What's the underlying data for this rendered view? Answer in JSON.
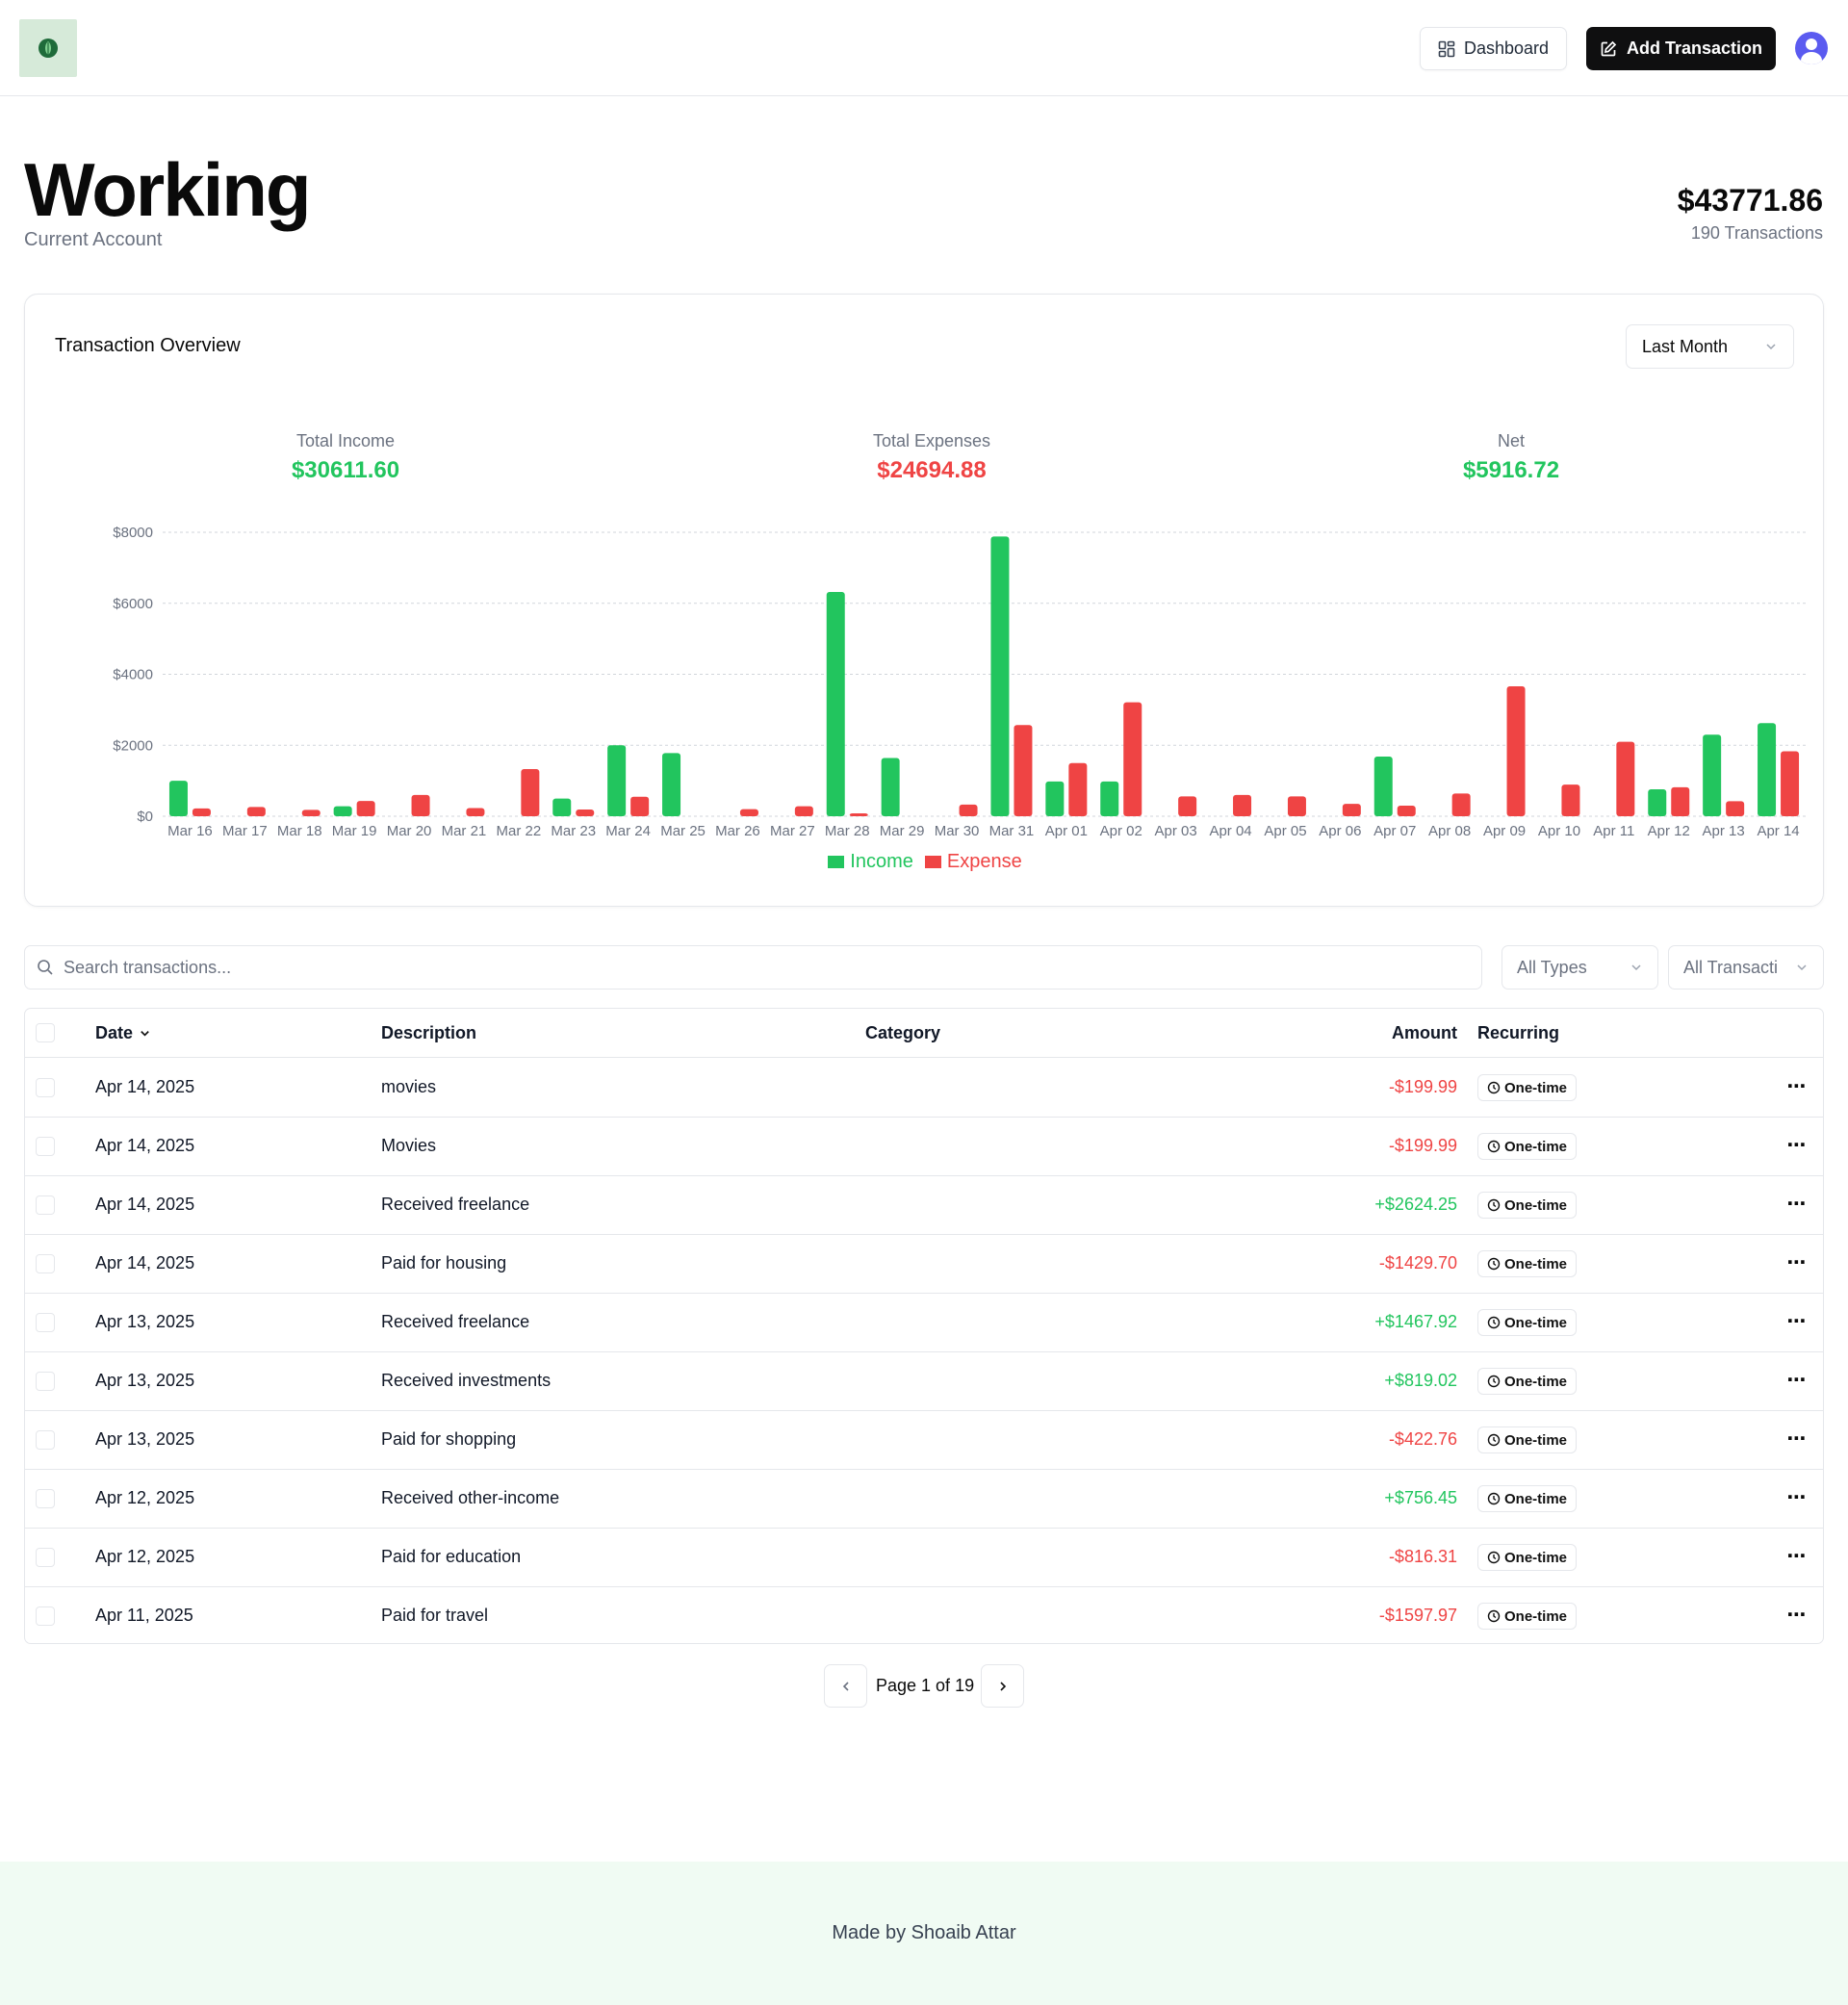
{
  "header": {
    "dashboard_label": "Dashboard",
    "add_label": "Add Transaction"
  },
  "account": {
    "name": "Working",
    "type": "Current Account",
    "balance": "$43771.86",
    "transactions": "190 Transactions"
  },
  "overview": {
    "title": "Transaction Overview",
    "period": "Last Month",
    "income_label": "Total Income",
    "income_value": "$30611.60",
    "expense_label": "Total Expenses",
    "expense_value": "$24694.88",
    "net_label": "Net",
    "net_value": "$5916.72",
    "legend_income": "Income",
    "legend_expense": "Expense"
  },
  "colors": {
    "income": "#22c55e",
    "expense": "#ef4444",
    "accent": "#0f0f10"
  },
  "chart_data": {
    "type": "bar",
    "categories": [
      "Mar 16",
      "Mar 17",
      "Mar 18",
      "Mar 19",
      "Mar 20",
      "Mar 21",
      "Mar 22",
      "Mar 23",
      "Mar 24",
      "Mar 25",
      "Mar 26",
      "Mar 27",
      "Mar 28",
      "Mar 29",
      "Mar 30",
      "Mar 31",
      "Apr 01",
      "Apr 02",
      "Apr 03",
      "Apr 04",
      "Apr 05",
      "Apr 06",
      "Apr 07",
      "Apr 08",
      "Apr 09",
      "Apr 10",
      "Apr 11",
      "Apr 12",
      "Apr 13",
      "Apr 14"
    ],
    "series": [
      {
        "name": "Income",
        "values": [
          1000,
          0,
          0,
          280,
          0,
          0,
          0,
          500,
          2000,
          1780,
          0,
          0,
          6320,
          1640,
          0,
          7880,
          980,
          980,
          0,
          0,
          0,
          0,
          1680,
          0,
          0,
          0,
          0,
          760,
          2300,
          2624
        ]
      },
      {
        "name": "Expense",
        "values": [
          220,
          260,
          180,
          430,
          600,
          230,
          1330,
          190,
          550,
          0,
          200,
          280,
          80,
          0,
          330,
          2570,
          1500,
          3210,
          560,
          600,
          560,
          350,
          300,
          640,
          3660,
          890,
          2100,
          816,
          423,
          1830
        ]
      }
    ],
    "yticks": [
      "$0",
      "$2000",
      "$4000",
      "$6000",
      "$8000"
    ],
    "ylim": [
      0,
      8000
    ],
    "grid": true,
    "legend": "bottom-center"
  },
  "filters": {
    "search_placeholder": "Search transactions...",
    "type": "All Types",
    "txn": "All Transacti"
  },
  "table": {
    "headers": {
      "date": "Date",
      "description": "Description",
      "category": "Category",
      "amount": "Amount",
      "recurring": "Recurring"
    },
    "rows": [
      {
        "date": "Apr 14, 2025",
        "description": "movies",
        "category": "",
        "amount": "-$199.99",
        "kind": "expense",
        "recurring": "One-time"
      },
      {
        "date": "Apr 14, 2025",
        "description": "Movies",
        "category": "",
        "amount": "-$199.99",
        "kind": "expense",
        "recurring": "One-time"
      },
      {
        "date": "Apr 14, 2025",
        "description": "Received freelance",
        "category": "",
        "amount": "+$2624.25",
        "kind": "income",
        "recurring": "One-time"
      },
      {
        "date": "Apr 14, 2025",
        "description": "Paid for housing",
        "category": "",
        "amount": "-$1429.70",
        "kind": "expense",
        "recurring": "One-time"
      },
      {
        "date": "Apr 13, 2025",
        "description": "Received freelance",
        "category": "",
        "amount": "+$1467.92",
        "kind": "income",
        "recurring": "One-time"
      },
      {
        "date": "Apr 13, 2025",
        "description": "Received investments",
        "category": "",
        "amount": "+$819.02",
        "kind": "income",
        "recurring": "One-time"
      },
      {
        "date": "Apr 13, 2025",
        "description": "Paid for shopping",
        "category": "",
        "amount": "-$422.76",
        "kind": "expense",
        "recurring": "One-time"
      },
      {
        "date": "Apr 12, 2025",
        "description": "Received other-income",
        "category": "",
        "amount": "+$756.45",
        "kind": "income",
        "recurring": "One-time"
      },
      {
        "date": "Apr 12, 2025",
        "description": "Paid for education",
        "category": "",
        "amount": "-$816.31",
        "kind": "expense",
        "recurring": "One-time"
      },
      {
        "date": "Apr 11, 2025",
        "description": "Paid for travel",
        "category": "",
        "amount": "-$1597.97",
        "kind": "expense",
        "recurring": "One-time"
      }
    ]
  },
  "pagination": {
    "label": "Page 1 of 19"
  },
  "footer": {
    "text": "Made by Shoaib Attar"
  },
  "icons": [
    "leaf-logo-icon",
    "dashboard-grid-icon",
    "edit-icon",
    "user-avatar-icon",
    "chevron-down-icon",
    "search-icon",
    "clock-icon",
    "more-horizontal-icon",
    "chevron-left-icon",
    "chevron-right-icon"
  ]
}
